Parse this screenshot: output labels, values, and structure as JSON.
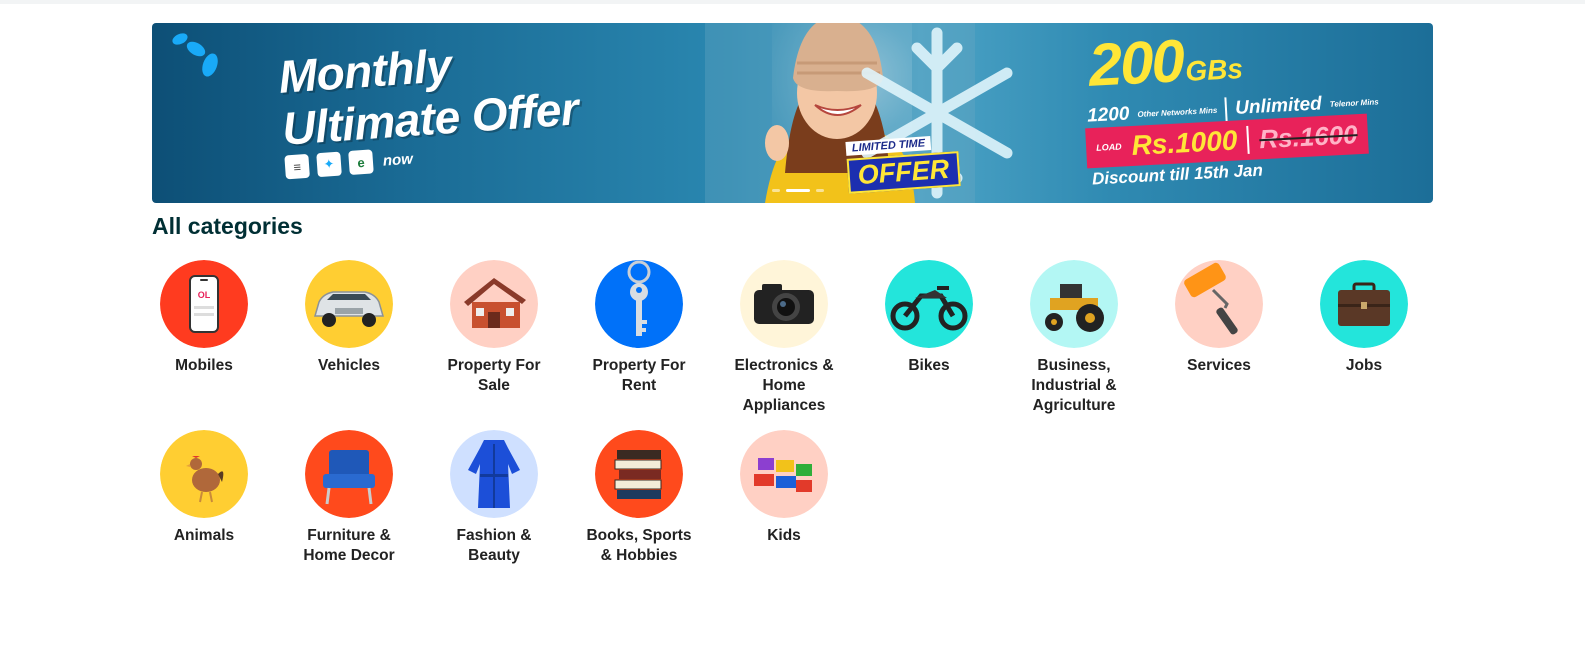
{
  "banner": {
    "headline_line1": "Monthly",
    "headline_line2": "Ultimate Offer",
    "apps_suffix": "now",
    "limited_line1": "LIMITED TIME",
    "limited_line2": "OFFER",
    "data_amount": "200",
    "data_unit": "GBs",
    "minutes_amount": "1200",
    "minutes_label": "Other Networks Mins",
    "unlimited_label": "Unlimited",
    "unlimited_sub": "Telenor Mins",
    "load_label": "LOAD",
    "new_price": "Rs.1000",
    "old_price": "Rs.1600",
    "discount_text": "Discount till 15th Jan",
    "slide_count": 3,
    "active_slide": 1,
    "colors": {
      "accent_yellow": "#ffe637",
      "price_pink": "#e8225a",
      "bg": "#1a6b95"
    }
  },
  "categories_section": {
    "title": "All categories",
    "items": [
      {
        "label": "Mobiles",
        "icon": "mobile-phone-icon",
        "bg": "#ff3b1f"
      },
      {
        "label": "Vehicles",
        "icon": "car-icon",
        "bg": "#ffce32"
      },
      {
        "label": "Property For Sale",
        "icon": "house-icon",
        "bg": "#ffd0c4"
      },
      {
        "label": "Property For Rent",
        "icon": "key-icon",
        "bg": "#0071f9"
      },
      {
        "label": "Electronics & Home Appliances",
        "icon": "camera-icon",
        "bg": "#fff5d9"
      },
      {
        "label": "Bikes",
        "icon": "motorcycle-icon",
        "bg": "#23e5db"
      },
      {
        "label": "Business, Industrial & Agriculture",
        "icon": "tractor-icon",
        "bg": "#b3f7f4"
      },
      {
        "label": "Services",
        "icon": "paint-roller-icon",
        "bg": "#ffd0c4"
      },
      {
        "label": "Jobs",
        "icon": "briefcase-icon",
        "bg": "#23e5db"
      },
      {
        "label": "Animals",
        "icon": "rooster-icon",
        "bg": "#ffce32"
      },
      {
        "label": "Furniture & Home Decor",
        "icon": "armchair-icon",
        "bg": "#ff4a1c"
      },
      {
        "label": "Fashion & Beauty",
        "icon": "dress-icon",
        "bg": "#cfe0ff"
      },
      {
        "label": "Books, Sports & Hobbies",
        "icon": "books-icon",
        "bg": "#ff4a1c"
      },
      {
        "label": "Kids",
        "icon": "toy-blocks-icon",
        "bg": "#ffd0c4"
      }
    ]
  }
}
